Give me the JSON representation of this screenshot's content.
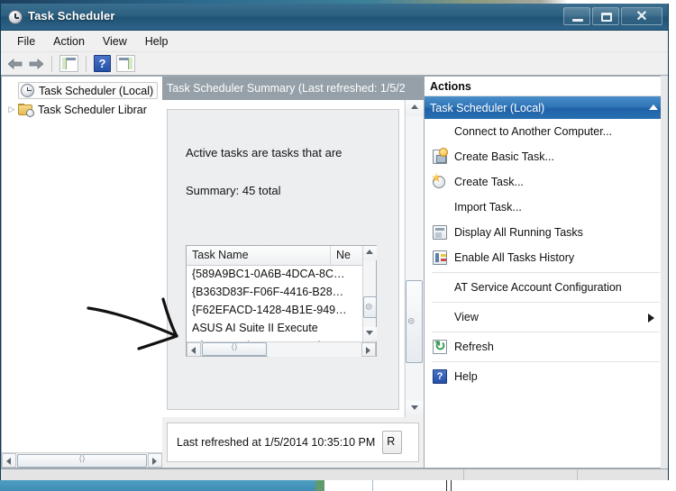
{
  "window": {
    "title": "Task Scheduler",
    "title_icon": "clock-icon",
    "minimize_label": "",
    "maximize_label": "",
    "close_label": "✕"
  },
  "menubar": {
    "items": [
      {
        "label": "File"
      },
      {
        "label": "Action"
      },
      {
        "label": "View"
      },
      {
        "label": "Help"
      }
    ]
  },
  "toolbar": {
    "back_icon": "back-arrow-icon",
    "forward_icon": "forward-arrow-icon",
    "show_hide_tree_icon": "show-hide-console-tree-icon",
    "help_icon": "help-icon",
    "show_hide_action_pane_icon": "show-hide-action-pane-icon",
    "help_glyph": "?"
  },
  "tree": {
    "items": [
      {
        "label": "Task Scheduler (Local)",
        "icon": "clock-icon",
        "selected": true,
        "expandable": false
      },
      {
        "label": "Task Scheduler Librar",
        "icon": "folder-clock-icon",
        "selected": false,
        "expandable": true
      }
    ]
  },
  "center": {
    "header": "Task Scheduler Summary (Last refreshed: 1/5/2",
    "summary_line_1": "Active tasks are tasks that are",
    "summary_line_2": "Summary: 45 total",
    "grid": {
      "columns": [
        "Task Name",
        "Ne"
      ],
      "rows": [
        {
          "name": "{589A9BC1-0A6B-4DCA-8C…"
        },
        {
          "name": "{B363D83F-F06F-4416-B28…"
        },
        {
          "name": "{F62EFACD-1428-4B1E-949…"
        },
        {
          "name": "ASUS AI Suite II Execute"
        },
        {
          "name": "BfeOnServiceStartTypeCha…"
        }
      ]
    },
    "status_text": "Last refreshed at 1/5/2014 10:35:10 PM",
    "refresh_button_label": "R"
  },
  "actions": {
    "title": "Actions",
    "group_header": "Task Scheduler (Local)",
    "group_collapse_icon": "chevron-up-icon",
    "items": [
      {
        "label": "Connect to Another Computer...",
        "icon": null,
        "submenu": false
      },
      {
        "label": "Create Basic Task...",
        "icon": "create-basic-task-icon",
        "submenu": false
      },
      {
        "label": "Create Task...",
        "icon": "create-task-icon",
        "submenu": false
      },
      {
        "label": "Import Task...",
        "icon": null,
        "submenu": false
      },
      {
        "label": "Display All Running Tasks",
        "icon": "display-running-tasks-icon",
        "submenu": false
      },
      {
        "label": "Enable All Tasks History",
        "icon": "enable-history-icon",
        "submenu": false
      },
      {
        "label": "AT Service Account Configuration",
        "icon": null,
        "submenu": false,
        "sep_before": true
      },
      {
        "label": "View",
        "icon": null,
        "submenu": true,
        "sep_before": true
      },
      {
        "label": "Refresh",
        "icon": "refresh-icon",
        "submenu": false,
        "sep_before": true
      },
      {
        "label": "Help",
        "icon": "help-icon",
        "submenu": false,
        "sep_before": true
      }
    ]
  },
  "annotation": {
    "type": "hand-drawn-arrow",
    "color": "#111111",
    "points_at": "ASUS AI Suite II Execute"
  },
  "colors": {
    "titlebar": "#2a5f81",
    "actions_header_blue": "#2f76b8",
    "center_header_gray": "#95a0a8",
    "window_chrome": "#f0f0f0"
  }
}
